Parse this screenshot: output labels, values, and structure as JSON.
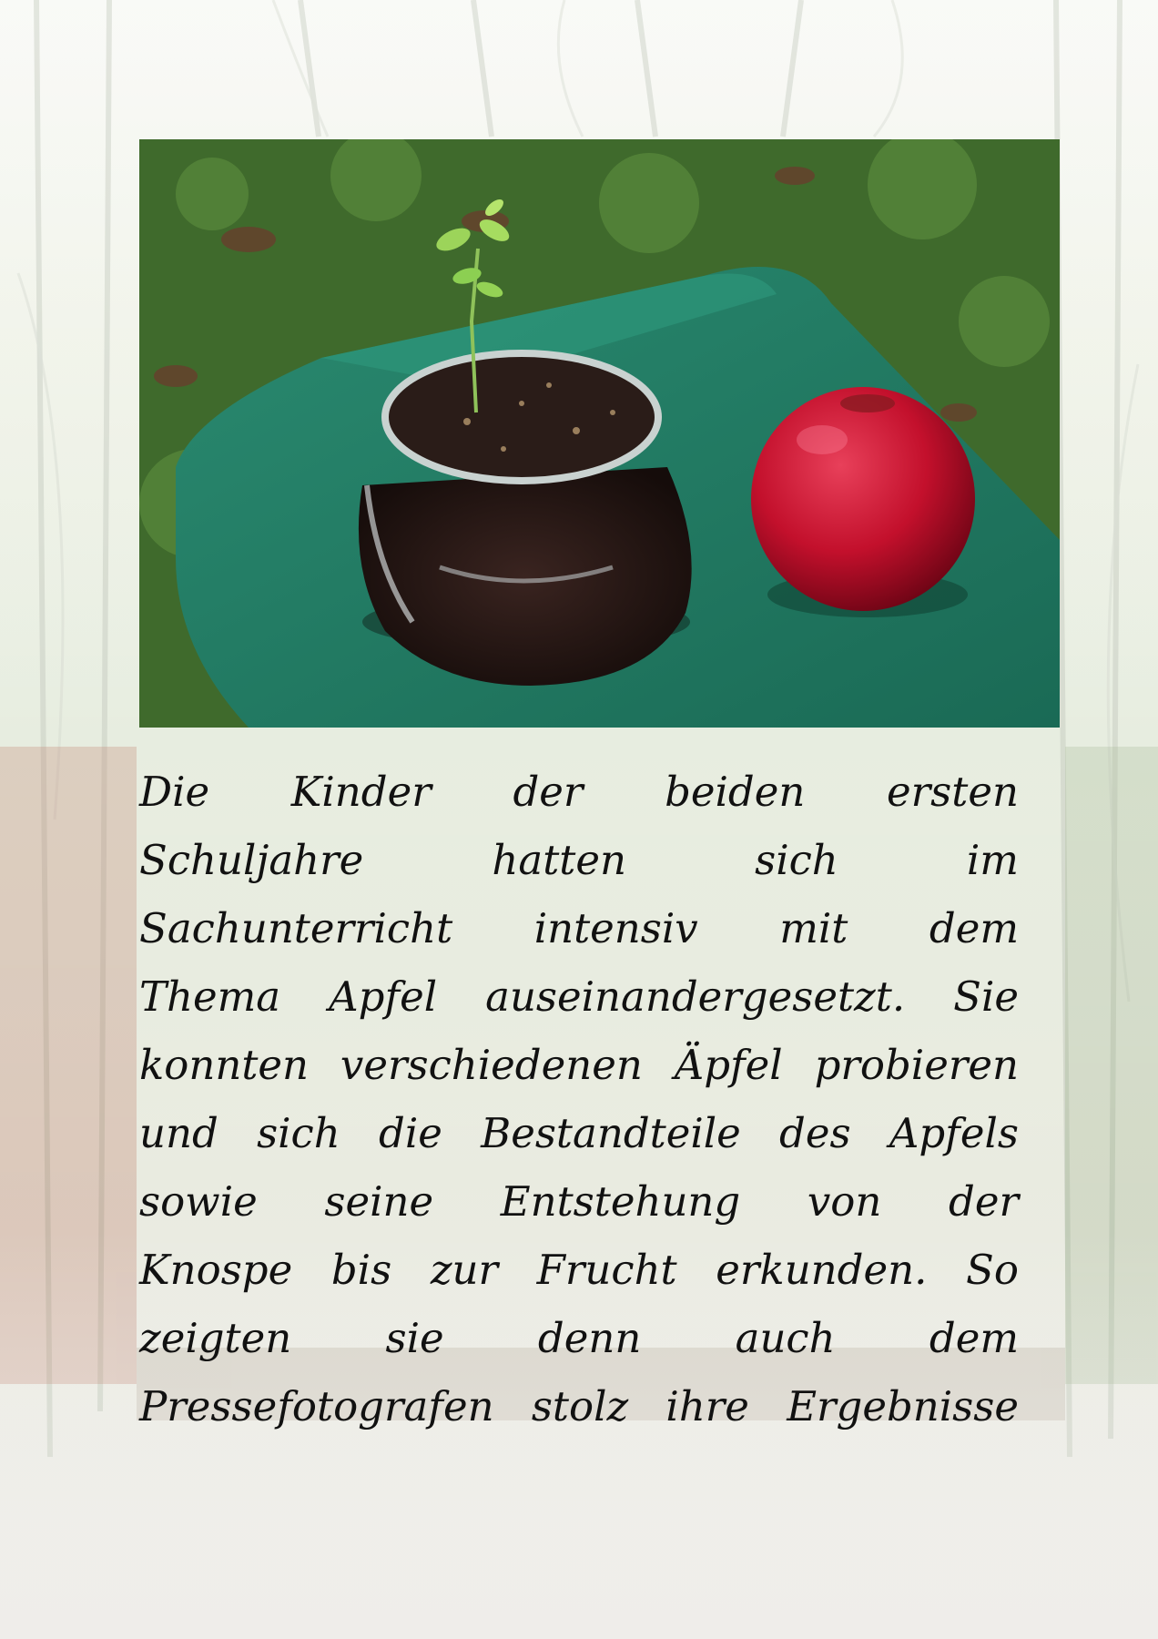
{
  "photo": {
    "alt": "Apfelbaum-Keimling im Glas neben einem roten Apfel"
  },
  "paragraph": {
    "lines": [
      [
        "Die",
        "Kinder",
        "der",
        "beiden",
        "ersten"
      ],
      [
        "Schuljahre",
        "hatten",
        "sich",
        "im"
      ],
      [
        "Sachunterricht",
        "intensiv",
        "mit",
        "dem"
      ],
      [
        "Thema",
        "Apfel",
        "auseinandergesetzt.",
        "Sie"
      ],
      [
        "konnten",
        "verschiedenen",
        "Äpfel",
        "probieren"
      ],
      [
        "und",
        "sich",
        "die",
        "Bestandteile",
        "des",
        "Apfels"
      ],
      [
        "sowie",
        "seine",
        "Entstehung",
        "von",
        "der"
      ],
      [
        "Knospe",
        "bis",
        "zur",
        "Frucht",
        "erkunden.",
        "So"
      ],
      [
        "zeigten",
        "sie",
        "denn",
        "auch",
        "dem"
      ],
      [
        "Pressefotografen",
        "stolz",
        "ihre",
        "Ergebnisse"
      ]
    ]
  },
  "colors": {
    "text": "#111111",
    "box_green": "#1f7a62",
    "apple_red": "#c8102e",
    "grass": "#3e6a2e"
  }
}
